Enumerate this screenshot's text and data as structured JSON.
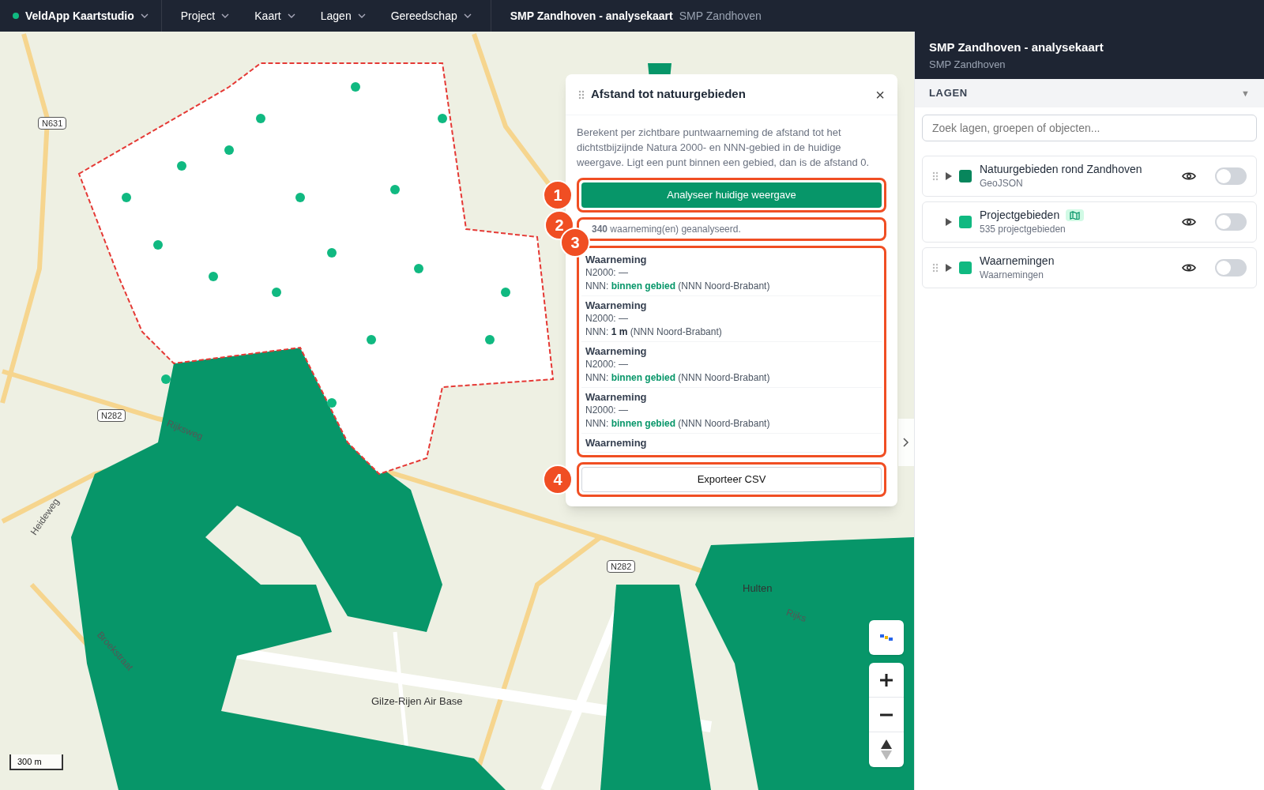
{
  "topbar": {
    "app": "VeldApp Kaartstudio",
    "menus": [
      "Project",
      "Kaart",
      "Lagen",
      "Gereedschap"
    ],
    "title": "SMP Zandhoven - analysekaart",
    "subtitle": "SMP Zandhoven"
  },
  "map": {
    "labels": [
      {
        "text": "N631",
        "kind": "shield"
      },
      {
        "text": "N282",
        "kind": "shield"
      },
      {
        "text": "N282",
        "kind": "shield"
      },
      {
        "text": "Rijksweg",
        "kind": "road"
      },
      {
        "text": "Heideweg",
        "kind": "road"
      },
      {
        "text": "Broekstraat",
        "kind": "road"
      },
      {
        "text": "Hulten",
        "kind": "place"
      },
      {
        "text": "Gilze-Rijen Air Base",
        "kind": "place"
      },
      {
        "text": "Rijks",
        "kind": "road"
      }
    ],
    "scale": "300 m"
  },
  "dialog": {
    "title": "Afstand tot natuurgebieden",
    "close": "×",
    "description": "Berekent per zichtbare puntwaarneming de afstand tot het dichtstbijzijnde Natura 2000- en NNN-gebied in de huidige weergave. Ligt een punt binnen een gebied, dan is de afstand 0.",
    "analyse_button": "Analyseer huidige weergave",
    "count": "**340** waarneming(en) geanalyseerd.",
    "results": [
      {
        "title": "Waarneming",
        "n2000": "N2000: —",
        "nnn_label": "NNN:",
        "nnn_value": "binnen gebied",
        "kind": "inside",
        "area": "(NNN Noord-Brabant)"
      },
      {
        "title": "Waarneming",
        "n2000": "N2000: —",
        "nnn_label": "NNN:",
        "nnn_value": "1 m",
        "kind": "distance",
        "area": "(NNN Noord-Brabant)"
      },
      {
        "title": "Waarneming",
        "n2000": "N2000: —",
        "nnn_label": "NNN:",
        "nnn_value": "binnen gebied",
        "kind": "inside",
        "area": "(NNN Noord-Brabant)"
      },
      {
        "title": "Waarneming",
        "n2000": "N2000: —",
        "nnn_label": "NNN:",
        "nnn_value": "binnen gebied",
        "kind": "inside",
        "area": "(NNN Noord-Brabant)"
      },
      {
        "title": "Waarneming",
        "kind": "partial"
      }
    ],
    "export_button": "Exporteer CSV"
  },
  "callouts": [
    "1",
    "2",
    "3",
    "4"
  ],
  "panel": {
    "title": "SMP Zandhoven - analysekaart",
    "subtitle": "SMP Zandhoven",
    "section": "LAGEN",
    "section_arrow": "▼",
    "search": {
      "placeholder": "Zoek lagen, groepen of objecten..."
    },
    "layers": [
      {
        "name": "Natuurgebieden rond Zandhoven",
        "sub": "GeoJSON",
        "color": "#07865c",
        "drag_handle": true,
        "badge": false,
        "on": false,
        "expanded": false
      },
      {
        "name": "Projectgebieden",
        "sub": "535 projectgebieden",
        "color": "#10b981",
        "drag_handle": false,
        "badge": true,
        "on": false,
        "expanded": false
      },
      {
        "name": "Waarnemingen",
        "sub": "Waarnemingen",
        "color": "#10b981",
        "drag_handle": true,
        "badge": false,
        "on": false,
        "expanded": false
      }
    ]
  }
}
